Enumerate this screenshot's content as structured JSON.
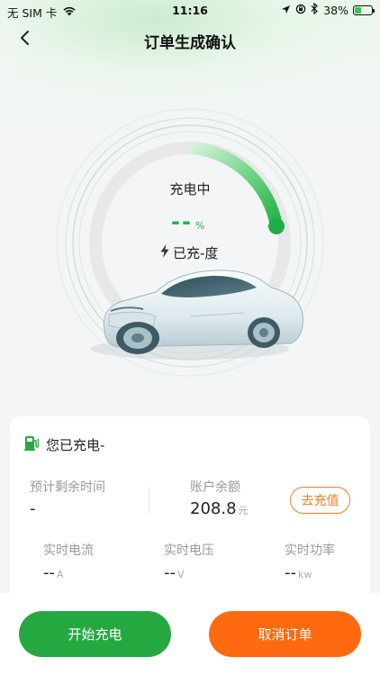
{
  "status_bar": {
    "carrier": "无 SIM 卡",
    "time": "11:16",
    "battery_percent": "38%",
    "battery_level": 0.38,
    "icons": [
      "wifi-icon",
      "location-icon",
      "rotation-lock-icon",
      "bluetooth-icon",
      "battery-icon"
    ]
  },
  "nav": {
    "title": "订单生成确认",
    "back_icon": "chevron-left-icon"
  },
  "gauge": {
    "status": "充电中",
    "percent_value": "--",
    "percent_unit": "%",
    "charged_text": "已充-度",
    "charged_icon": "lightning-icon",
    "accent_color": "#20b24a"
  },
  "card": {
    "header_icon": "charging-pile-icon",
    "header_text": "您已充电-",
    "remaining_time_label": "预计剩余时间",
    "remaining_time_value": "-",
    "balance_label": "账户余额",
    "balance_value": "208.8",
    "balance_unit": "元",
    "recharge_label": "去充值",
    "current_label": "实时电流",
    "current_value": "--",
    "current_unit": "A",
    "voltage_label": "实时电压",
    "voltage_value": "--",
    "voltage_unit": "V",
    "power_label": "实时功率",
    "power_value": "--",
    "power_unit": "kw"
  },
  "actions": {
    "start_label": "开始充电",
    "cancel_label": "取消订单",
    "start_color": "#26a841",
    "cancel_color": "#ff6a10"
  }
}
